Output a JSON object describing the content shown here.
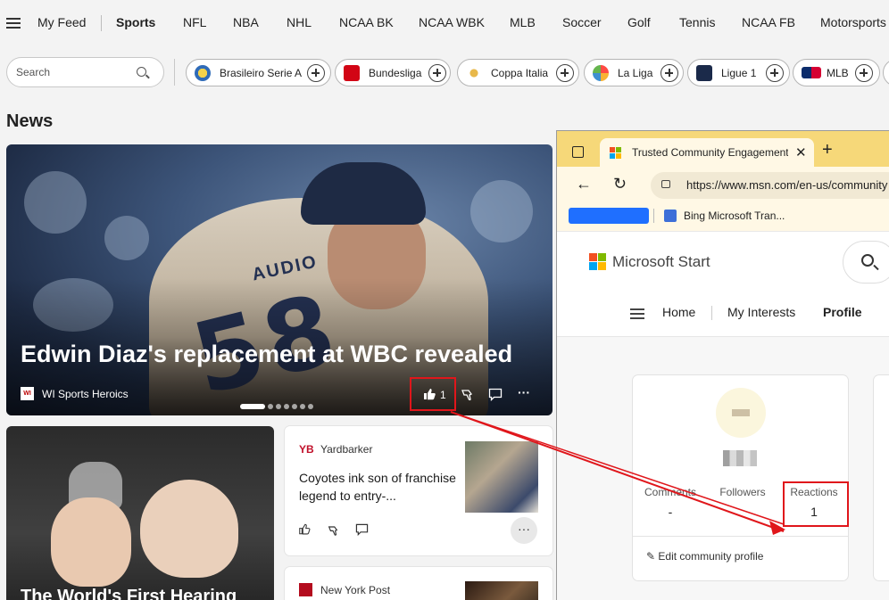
{
  "nav": {
    "items": [
      "My Feed",
      "Sports",
      "NFL",
      "NBA",
      "NHL",
      "NCAA BK",
      "NCAA WBK",
      "MLB",
      "Soccer",
      "Golf",
      "Tennis",
      "NCAA FB",
      "Motorsports"
    ],
    "active": "Sports"
  },
  "search": {
    "placeholder": "Search"
  },
  "chips": [
    "Brasileiro Serie A",
    "Bundesliga",
    "Coppa Italia",
    "La Liga",
    "Ligue 1",
    "MLB"
  ],
  "news": {
    "section_title": "News",
    "hero": {
      "headline": "Edwin Diaz's replacement at WBC revealed",
      "source": "WI Sports Heroics",
      "jersey_text": "AUDIO",
      "jersey_number": "58",
      "like_count": "1",
      "carousel_total": 7,
      "carousel_active": 0
    },
    "card_hearing": {
      "title": "The World's First Hearing"
    },
    "card_yardbarker": {
      "source": "Yardbarker",
      "logo_text": "YB",
      "title": "Coyotes ink son of franchise legend to entry-..."
    },
    "card_nypost": {
      "source": "New York Post"
    }
  },
  "popup": {
    "tab_title": "Trusted Community Engagement",
    "url": "https://www.msn.com/en-us/community",
    "favorite": "Bing Microsoft Tran...",
    "brand": "Microsoft Start",
    "nav": {
      "home": "Home",
      "interests": "My Interests",
      "profile": "Profile"
    },
    "profile": {
      "comments_label": "Comments",
      "comments_value": "-",
      "followers_label": "Followers",
      "reactions_label": "Reactions",
      "reactions_value": "1",
      "edit_label": "Edit community profile"
    }
  },
  "colors": {
    "highlight": "#e0161b",
    "tab_bar": "#f6d879",
    "background": "#f3f3f3"
  }
}
